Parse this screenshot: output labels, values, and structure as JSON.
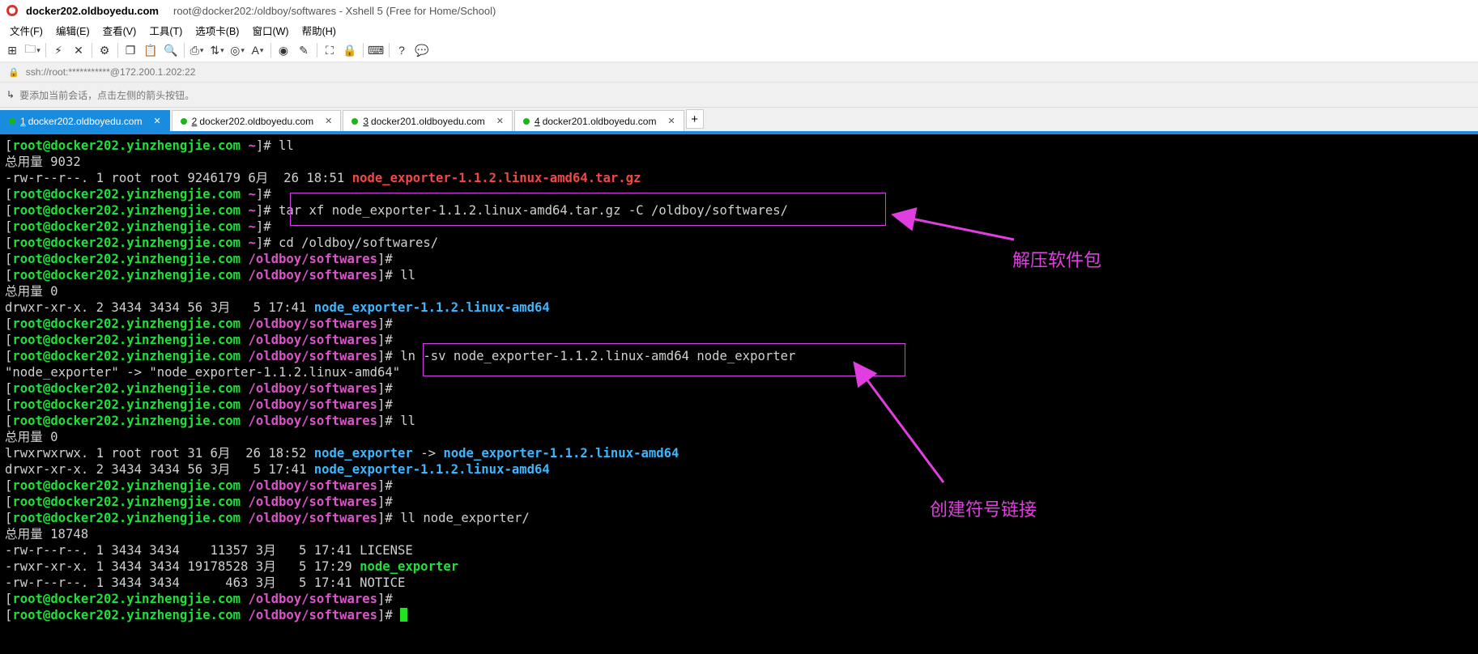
{
  "window": {
    "app_title": "docker202.oldboyedu.com",
    "subtitle": "root@docker202:/oldboy/softwares - Xshell 5 (Free for Home/School)"
  },
  "menu": [
    "文件(F)",
    "编辑(E)",
    "查看(V)",
    "工具(T)",
    "选项卡(B)",
    "窗口(W)",
    "帮助(H)"
  ],
  "address": "ssh://root:***********@172.200.1.202:22",
  "hint": "要添加当前会话，点击左侧的箭头按钮。",
  "tabs": [
    {
      "num": "1",
      "label": "docker202.oldboyedu.com",
      "active": true
    },
    {
      "num": "2",
      "label": "docker202.oldboyedu.com",
      "active": false
    },
    {
      "num": "3",
      "label": "docker201.oldboyedu.com",
      "active": false
    },
    {
      "num": "4",
      "label": "docker201.oldboyedu.com",
      "active": false
    }
  ],
  "new_tab": "+",
  "terminal": [
    [
      [
        "w",
        "["
      ],
      [
        "g",
        "root@docker202.yinzhengjie.com"
      ],
      [
        "w",
        " "
      ],
      [
        "m",
        "~"
      ],
      [
        "w",
        "]# ll"
      ]
    ],
    [
      [
        "w",
        "总用量 9032"
      ]
    ],
    [
      [
        "w",
        "-rw-r--r--. 1 root root 9246179 6月  26 18:51 "
      ],
      [
        "r",
        "node_exporter-1.1.2.linux-amd64.tar.gz"
      ]
    ],
    [
      [
        "w",
        "["
      ],
      [
        "g",
        "root@docker202.yinzhengjie.com"
      ],
      [
        "w",
        " "
      ],
      [
        "m",
        "~"
      ],
      [
        "w",
        "]# "
      ]
    ],
    [
      [
        "w",
        "["
      ],
      [
        "g",
        "root@docker202.yinzhengjie.com"
      ],
      [
        "w",
        " "
      ],
      [
        "m",
        "~"
      ],
      [
        "w",
        "]# tar xf node_exporter-1.1.2.linux-amd64.tar.gz -C /oldboy/softwares/"
      ]
    ],
    [
      [
        "w",
        "["
      ],
      [
        "g",
        "root@docker202.yinzhengjie.com"
      ],
      [
        "w",
        " "
      ],
      [
        "m",
        "~"
      ],
      [
        "w",
        "]# "
      ]
    ],
    [
      [
        "w",
        "["
      ],
      [
        "g",
        "root@docker202.yinzhengjie.com"
      ],
      [
        "w",
        " "
      ],
      [
        "m",
        "~"
      ],
      [
        "w",
        "]# cd /oldboy/softwares/"
      ]
    ],
    [
      [
        "w",
        "["
      ],
      [
        "g",
        "root@docker202.yinzhengjie.com"
      ],
      [
        "w",
        " "
      ],
      [
        "m",
        "/oldboy/softwares"
      ],
      [
        "w",
        "]# "
      ]
    ],
    [
      [
        "w",
        "["
      ],
      [
        "g",
        "root@docker202.yinzhengjie.com"
      ],
      [
        "w",
        " "
      ],
      [
        "m",
        "/oldboy/softwares"
      ],
      [
        "w",
        "]# ll"
      ]
    ],
    [
      [
        "w",
        "总用量 0"
      ]
    ],
    [
      [
        "w",
        "drwxr-xr-x. 2 3434 3434 56 3月   5 17:41 "
      ],
      [
        "b",
        "node_exporter-1.1.2.linux-amd64"
      ]
    ],
    [
      [
        "w",
        "["
      ],
      [
        "g",
        "root@docker202.yinzhengjie.com"
      ],
      [
        "w",
        " "
      ],
      [
        "m",
        "/oldboy/softwares"
      ],
      [
        "w",
        "]# "
      ]
    ],
    [
      [
        "w",
        "["
      ],
      [
        "g",
        "root@docker202.yinzhengjie.com"
      ],
      [
        "w",
        " "
      ],
      [
        "m",
        "/oldboy/softwares"
      ],
      [
        "w",
        "]# "
      ]
    ],
    [
      [
        "w",
        "["
      ],
      [
        "g",
        "root@docker202.yinzhengjie.com"
      ],
      [
        "w",
        " "
      ],
      [
        "m",
        "/oldboy/softwares"
      ],
      [
        "w",
        "]# ln -sv node_exporter-1.1.2.linux-amd64 node_exporter"
      ]
    ],
    [
      [
        "w",
        "\"node_exporter\" -> \"node_exporter-1.1.2.linux-amd64\""
      ]
    ],
    [
      [
        "w",
        "["
      ],
      [
        "g",
        "root@docker202.yinzhengjie.com"
      ],
      [
        "w",
        " "
      ],
      [
        "m",
        "/oldboy/softwares"
      ],
      [
        "w",
        "]# "
      ]
    ],
    [
      [
        "w",
        "["
      ],
      [
        "g",
        "root@docker202.yinzhengjie.com"
      ],
      [
        "w",
        " "
      ],
      [
        "m",
        "/oldboy/softwares"
      ],
      [
        "w",
        "]# "
      ]
    ],
    [
      [
        "w",
        "["
      ],
      [
        "g",
        "root@docker202.yinzhengjie.com"
      ],
      [
        "w",
        " "
      ],
      [
        "m",
        "/oldboy/softwares"
      ],
      [
        "w",
        "]# ll"
      ]
    ],
    [
      [
        "w",
        "总用量 0"
      ]
    ],
    [
      [
        "w",
        "lrwxrwxrwx. 1 root root 31 6月  26 18:52 "
      ],
      [
        "b",
        "node_exporter"
      ],
      [
        "w",
        " -> "
      ],
      [
        "b",
        "node_exporter-1.1.2.linux-amd64"
      ]
    ],
    [
      [
        "w",
        "drwxr-xr-x. 2 3434 3434 56 3月   5 17:41 "
      ],
      [
        "b",
        "node_exporter-1.1.2.linux-amd64"
      ]
    ],
    [
      [
        "w",
        "["
      ],
      [
        "g",
        "root@docker202.yinzhengjie.com"
      ],
      [
        "w",
        " "
      ],
      [
        "m",
        "/oldboy/softwares"
      ],
      [
        "w",
        "]# "
      ]
    ],
    [
      [
        "w",
        "["
      ],
      [
        "g",
        "root@docker202.yinzhengjie.com"
      ],
      [
        "w",
        " "
      ],
      [
        "m",
        "/oldboy/softwares"
      ],
      [
        "w",
        "]# "
      ]
    ],
    [
      [
        "w",
        "["
      ],
      [
        "g",
        "root@docker202.yinzhengjie.com"
      ],
      [
        "w",
        " "
      ],
      [
        "m",
        "/oldboy/softwares"
      ],
      [
        "w",
        "]# ll node_exporter/"
      ]
    ],
    [
      [
        "w",
        "总用量 18748"
      ]
    ],
    [
      [
        "w",
        "-rw-r--r--. 1 3434 3434    11357 3月   5 17:41 LICENSE"
      ]
    ],
    [
      [
        "w",
        "-rwxr-xr-x. 1 3434 3434 19178528 3月   5 17:29 "
      ],
      [
        "g",
        "node_exporter"
      ]
    ],
    [
      [
        "w",
        "-rw-r--r--. 1 3434 3434      463 3月   5 17:41 NOTICE"
      ]
    ],
    [
      [
        "w",
        "["
      ],
      [
        "g",
        "root@docker202.yinzhengjie.com"
      ],
      [
        "w",
        " "
      ],
      [
        "m",
        "/oldboy/softwares"
      ],
      [
        "w",
        "]# "
      ]
    ],
    [
      [
        "w",
        "["
      ],
      [
        "g",
        "root@docker202.yinzhengjie.com"
      ],
      [
        "w",
        " "
      ],
      [
        "m",
        "/oldboy/softwares"
      ],
      [
        "w",
        "]# "
      ]
    ]
  ],
  "annotations": {
    "extract_note": "解压软件包",
    "symlink_note": "创建符号链接"
  },
  "colors": {
    "prompt_user": "#1fe03a",
    "prompt_path": "#d955c8",
    "archive": "#f04848",
    "directory": "#3cb6ff",
    "annotation": "#d63ce8",
    "tab_active": "#1a8ce0"
  }
}
